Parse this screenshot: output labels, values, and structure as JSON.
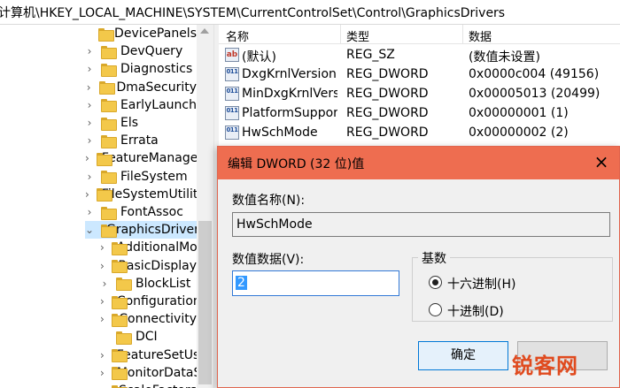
{
  "address": "计算机\\HKEY_LOCAL_MACHINE\\SYSTEM\\CurrentControlSet\\Control\\GraphicsDrivers",
  "tree": [
    {
      "label": "DevicePanels",
      "indent": 1,
      "expander": "none"
    },
    {
      "label": "DevQuery",
      "indent": 1,
      "expander": ">"
    },
    {
      "label": "Diagnostics",
      "indent": 1,
      "expander": ">"
    },
    {
      "label": "DmaSecurity",
      "indent": 1,
      "expander": ">"
    },
    {
      "label": "EarlyLaunch",
      "indent": 1,
      "expander": ">"
    },
    {
      "label": "Els",
      "indent": 1,
      "expander": ">"
    },
    {
      "label": "Errata",
      "indent": 1,
      "expander": ">"
    },
    {
      "label": "FeatureManagement",
      "indent": 1,
      "expander": ">"
    },
    {
      "label": "FileSystem",
      "indent": 1,
      "expander": ">"
    },
    {
      "label": "FileSystemUtilities",
      "indent": 1,
      "expander": ">"
    },
    {
      "label": "FontAssoc",
      "indent": 1,
      "expander": ">"
    },
    {
      "label": "GraphicsDrivers",
      "indent": 1,
      "expander": "v",
      "selected": true
    },
    {
      "label": "AdditionalModeLists",
      "indent": 2,
      "expander": ">"
    },
    {
      "label": "BasicDisplay",
      "indent": 2,
      "expander": ">"
    },
    {
      "label": "BlockList",
      "indent": 2,
      "expander": ">"
    },
    {
      "label": "Configuration",
      "indent": 2,
      "expander": ">"
    },
    {
      "label": "Connectivity",
      "indent": 2,
      "expander": ">"
    },
    {
      "label": "DCI",
      "indent": 2,
      "expander": "none"
    },
    {
      "label": "FeatureSetUsage",
      "indent": 2,
      "expander": ">"
    },
    {
      "label": "MonitorDataStore",
      "indent": 2,
      "expander": ">"
    },
    {
      "label": "ScaleFactors",
      "indent": 2,
      "expander": ">"
    }
  ],
  "list": {
    "headers": {
      "name": "名称",
      "type": "类型",
      "data": "数据"
    },
    "rows": [
      {
        "icon": "ab",
        "name": "(默认)",
        "type": "REG_SZ",
        "data": "(数值未设置)"
      },
      {
        "icon": "011",
        "name": "DxgKrnlVersion",
        "type": "REG_DWORD",
        "data": "0x0000c004 (49156)"
      },
      {
        "icon": "011",
        "name": "MinDxgKrnlVersion",
        "type": "REG_DWORD",
        "data": "0x00005013 (20499)"
      },
      {
        "icon": "011",
        "name": "PlatformSupportMiracast",
        "type": "REG_DWORD",
        "data": "0x00000001 (1)"
      },
      {
        "icon": "011",
        "name": "HwSchMode",
        "type": "REG_DWORD",
        "data": "0x00000002 (2)"
      }
    ]
  },
  "dialog": {
    "title": "编辑 DWORD (32 位)值",
    "close": "×",
    "name_label": "数值名称(N):",
    "name_value": "HwSchMode",
    "data_label": "数值数据(V):",
    "data_value": "2",
    "base_label": "基数",
    "hex_label": "十六进制(H)",
    "dec_label": "十进制(D)",
    "base_selected": "hex",
    "ok_label": "确定",
    "cancel_label": ""
  },
  "watermark": "锐客网",
  "colors": {
    "titlebar": "#ee6d50",
    "selection": "#cce8ff",
    "accent": "#0078d7"
  }
}
